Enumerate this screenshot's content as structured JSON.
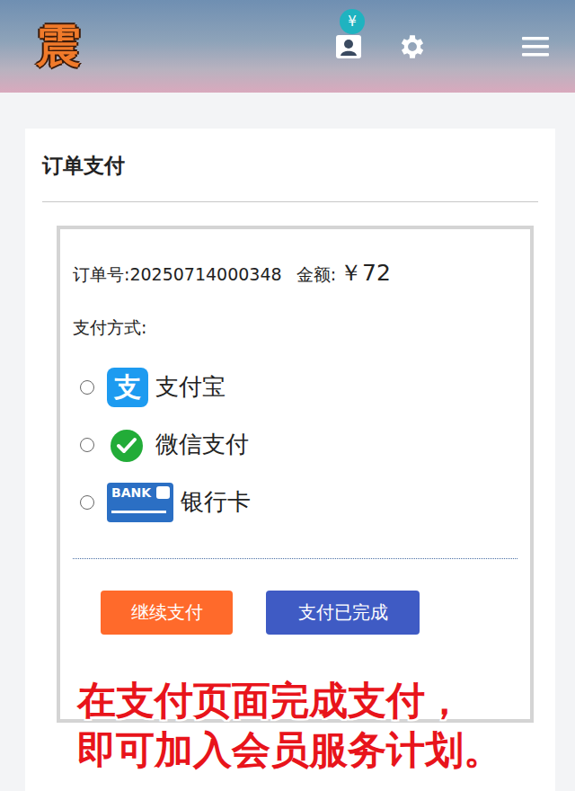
{
  "header": {
    "logo": "震",
    "badge": "¥"
  },
  "page": {
    "title": "订单支付"
  },
  "order": {
    "number": "订单号:20250714000348",
    "amount_label": "金额:",
    "amount": "￥72"
  },
  "payment": {
    "label": "支付方式:",
    "methods": [
      {
        "name": "支付宝",
        "kind": "alipay",
        "icon_text": "支",
        "selected": false
      },
      {
        "name": "微信支付",
        "kind": "wechat",
        "icon_text": "",
        "selected": false
      },
      {
        "name": "银行卡",
        "kind": "bank",
        "icon_text": "BANK",
        "selected": false
      }
    ]
  },
  "buttons": [
    {
      "label": "继续支付",
      "color": "#ff6a2b"
    },
    {
      "label": "支付已完成",
      "color": "#3f5bc4"
    }
  ],
  "caption": {
    "lines": [
      "在支付页面完成支付，",
      "即可加入会员服务计划。"
    ]
  }
}
